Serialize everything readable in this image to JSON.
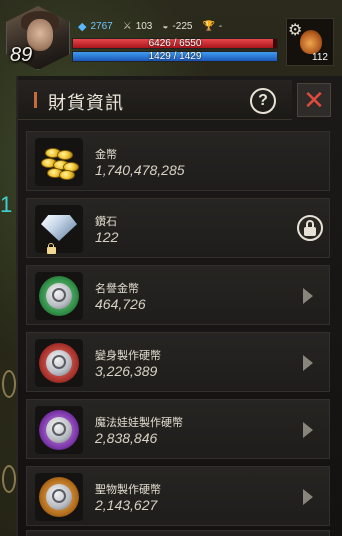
{
  "hud": {
    "level": "89",
    "gem_value": "2767",
    "attack": "103",
    "defense": "-225",
    "trophy": "-",
    "hp_text": "6426 / 6550",
    "hp_fraction": 0.981,
    "mp_text": "1429 / 1429",
    "mp_fraction": 1.0,
    "item_count": "112"
  },
  "panel": {
    "title": "財貨資訊",
    "help_label": "?",
    "close_label": "✕"
  },
  "currencies": [
    {
      "name": "金幣",
      "value": "1,740,478,285",
      "icon": "gold-coins-icon"
    },
    {
      "name": "鑽石",
      "value": "122",
      "icon": "diamond-icon",
      "locked": true
    },
    {
      "name": "名譽金幣",
      "value": "464,726",
      "icon": "honor-coin-icon",
      "ring_color": "#3fae5c"
    },
    {
      "name": "變身製作硬幣",
      "value": "3,226,389",
      "icon": "polymorph-coin-icon",
      "ring_color": "#c0463a"
    },
    {
      "name": "魔法娃娃製作硬幣",
      "value": "2,838,846",
      "icon": "magic-doll-coin-icon",
      "ring_color": "#9a4ec2"
    },
    {
      "name": "聖物製作硬幣",
      "value": "2,143,627",
      "icon": "relic-coin-icon",
      "ring_color": "#d08a2a"
    }
  ],
  "colors": {
    "accent": "#c56b3d",
    "close": "#e04a3c",
    "hp": "#d52a2e",
    "mp": "#2f7ad8"
  }
}
